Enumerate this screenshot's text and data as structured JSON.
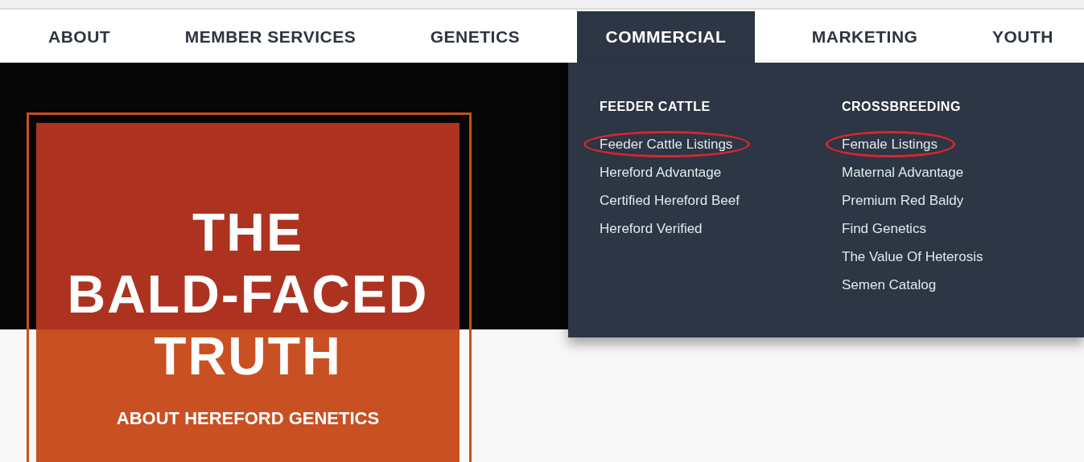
{
  "nav": [
    {
      "label": "ABOUT",
      "selected": false
    },
    {
      "label": "MEMBER SERVICES",
      "selected": false
    },
    {
      "label": "GENETICS",
      "selected": false
    },
    {
      "label": "COMMERCIAL",
      "selected": true
    },
    {
      "label": "MARKETING",
      "selected": false
    },
    {
      "label": "YOUTH",
      "selected": false
    }
  ],
  "dropdown": {
    "columns": [
      {
        "heading": "FEEDER CATTLE",
        "items": [
          {
            "label": "Feeder Cattle Listings",
            "circled": true
          },
          {
            "label": "Hereford Advantage",
            "circled": false
          },
          {
            "label": "Certified Hereford Beef",
            "circled": false
          },
          {
            "label": "Hereford Verified",
            "circled": false
          }
        ]
      },
      {
        "heading": "CROSSBREEDING",
        "items": [
          {
            "label": "Female Listings",
            "circled": true
          },
          {
            "label": "Maternal Advantage",
            "circled": false
          },
          {
            "label": "Premium Red Baldy",
            "circled": false
          },
          {
            "label": "Find Genetics",
            "circled": false
          },
          {
            "label": "The Value Of Heterosis",
            "circled": false
          },
          {
            "label": "Semen Catalog",
            "circled": false
          }
        ]
      }
    ]
  },
  "hero": {
    "title_lines": [
      "THE",
      "BALD-FACED",
      "TRUTH"
    ],
    "subtitle": "ABOUT HEREFORD GENETICS"
  }
}
